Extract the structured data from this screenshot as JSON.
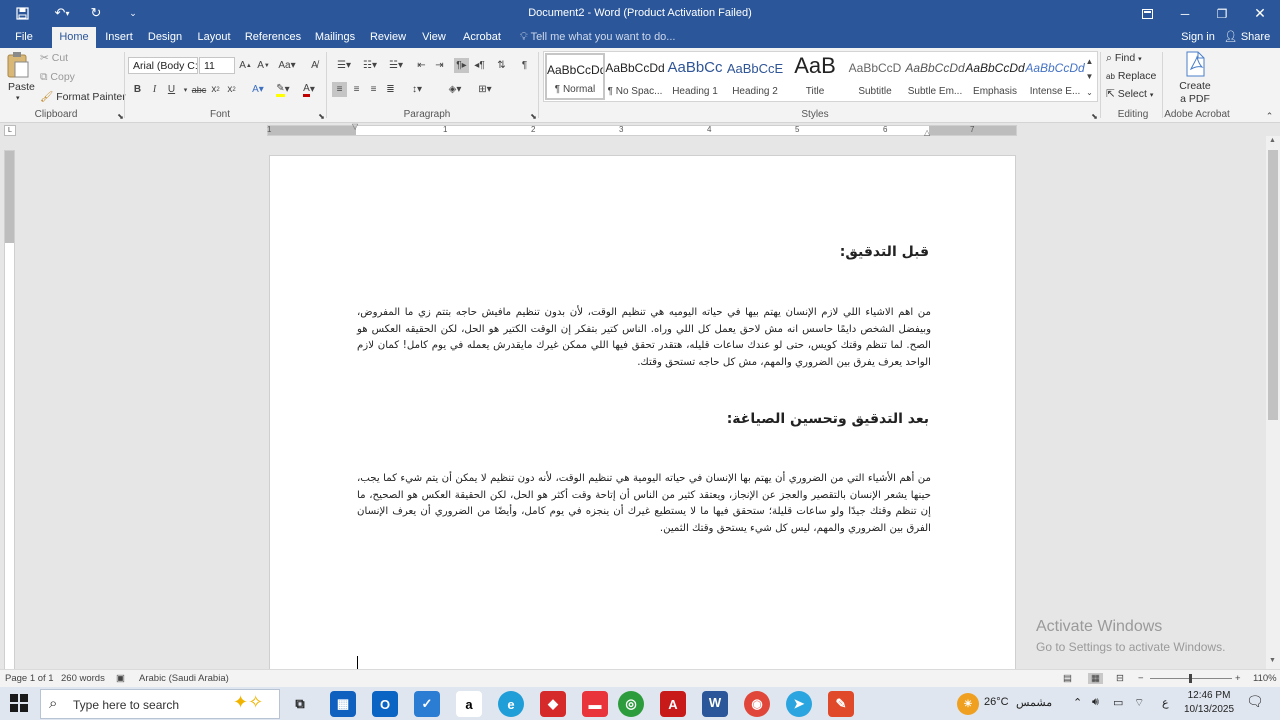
{
  "window": {
    "title": "Document2 - Word (Product Activation Failed)"
  },
  "tabs": [
    "File",
    "Home",
    "Insert",
    "Design",
    "Layout",
    "References",
    "Mailings",
    "Review",
    "View",
    "Acrobat"
  ],
  "tell_me": "Tell me what you want to do...",
  "account": {
    "sign_in": "Sign in",
    "share": "Share"
  },
  "clipboard": {
    "paste": "Paste",
    "cut": "Cut",
    "copy": "Copy",
    "format_painter": "Format Painter",
    "label": "Clipboard"
  },
  "font": {
    "name": "Arial (Body C:",
    "size": "11",
    "label": "Font"
  },
  "paragraph": {
    "label": "Paragraph"
  },
  "styles": {
    "label": "Styles",
    "items": [
      {
        "sample": "AaBbCcDd",
        "name": "¶ Normal"
      },
      {
        "sample": "AaBbCcDd",
        "name": "¶ No Spac..."
      },
      {
        "sample": "AaBbCc",
        "name": "Heading 1"
      },
      {
        "sample": "AaBbCcE",
        "name": "Heading 2"
      },
      {
        "sample": "AaB",
        "name": "Title"
      },
      {
        "sample": "AaBbCcD",
        "name": "Subtitle"
      },
      {
        "sample": "AaBbCcDd",
        "name": "Subtle Em..."
      },
      {
        "sample": "AaBbCcDd",
        "name": "Emphasis"
      },
      {
        "sample": "AaBbCcDd",
        "name": "Intense E..."
      }
    ]
  },
  "editing": {
    "find": "Find",
    "replace": "Replace",
    "select": "Select",
    "label": "Editing"
  },
  "acrobat": {
    "create_pdf_1": "Create",
    "create_pdf_2": "a PDF",
    "label": "Adobe Acrobat"
  },
  "ruler": {
    "numbers": [
      "1",
      "1",
      "2",
      "3",
      "4",
      "5",
      "6",
      "7"
    ]
  },
  "document": {
    "heading1": "قبل التدقيق:",
    "para1": "من اهم الاشياء اللي لازم الإنسان يهتم بيها في حياته اليوميه هي تنظيم الوقت، لأن بدون تنظيم مافيش حاجه بتتم زي ما المفروض، وبيفضل الشخص دايمًا حاسس انه مش لاحق يعمل كل اللي وراه. الناس كتير بتفكر إن الوقت الكتير هو الحل، لكن الحقيقه العكس هو الصح. لما تنظم وقتك كويس، حتى لو عندك ساعات قليله، هتقدر تحقق فيها اللي ممكن غيرك مايقدرش يعمله في يوم كامل! كمان لازم الواحد يعرف يفرق بين الضروري والمهم، مش كل حاجه تستحق وقتك.",
    "heading2": "بعد التدقيق وتحسين الصياغة:",
    "para2": "من أهم الأشياء التي من الضروري أن يهتم بها الإنسان في حياته اليومية هي تنظيم الوقت، لأنه دون تنظيم لا يمكن أن يتم شيء كما يجب، حينها يشعر الإنسان بالتقصير والعجز عن الإنجاز، ويعتقد كثير من الناس أن إتاحة وقت أكثر هو الحل، لكن الحقيقة العكس هو الصحيح، ما إن تنظم وقتك جيدًا ولو ساعات قليلة؛ ستحقق فيها ما لا يستطيع غيرك أن ينجزه في يوم كامل، وأيضًا من الضروري أن يعرف الإنسان الفرق بين الضروري والمهم، ليس كل شيء يستحق وقتك الثمين."
  },
  "watermark": {
    "line1": "Activate Windows",
    "line2": "Go to Settings to activate Windows."
  },
  "status": {
    "page": "Page 1 of 1",
    "words": "260 words",
    "language": "Arabic (Saudi Arabia)",
    "zoom": "110%"
  },
  "taskbar": {
    "search": "Type here to search",
    "weather": "26°C",
    "weather_desc": "مشمس",
    "time": "12:46 PM",
    "date": "10/13/2025",
    "lang": "ع"
  }
}
